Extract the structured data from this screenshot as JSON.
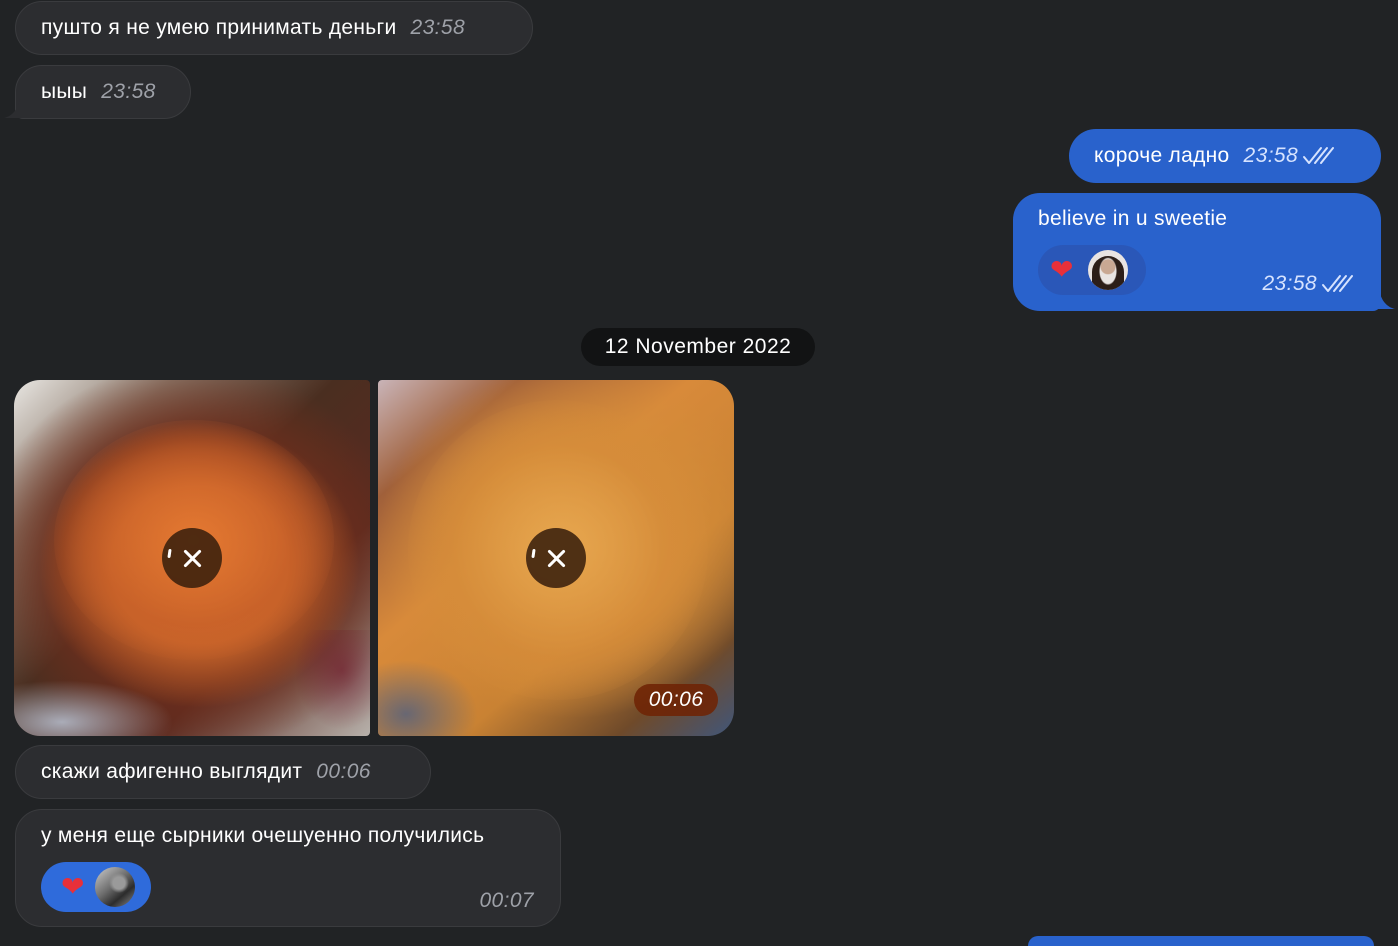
{
  "chat": {
    "messages": [
      {
        "text": "пушто я не умею принимать деньги",
        "time": "23:58"
      },
      {
        "text": "ыыы",
        "time": "23:58"
      },
      {
        "text": "короче ладно",
        "time": "23:58"
      },
      {
        "text": "believe in u sweetie",
        "time": "23:58",
        "reaction": "heart"
      },
      {
        "text": "скажи афигенно выглядит",
        "time": "00:06"
      },
      {
        "text": "у меня еще сырники очешуенно получились",
        "time": "00:07",
        "reaction": "heart"
      }
    ],
    "date_separator": "12 November 2022",
    "media": {
      "video_duration": "00:06"
    }
  },
  "colors": {
    "background": "#212325",
    "incoming_bubble": "#2c2d30",
    "outgoing_bubble": "#2962cc",
    "reaction_pill_outgoing": "#2a57b8",
    "reaction_pill_incoming": "#2f6bdb"
  },
  "icons": {
    "read_receipt": "double-check-icon",
    "reaction": "heart-icon",
    "download_cancel": "close-icon"
  }
}
